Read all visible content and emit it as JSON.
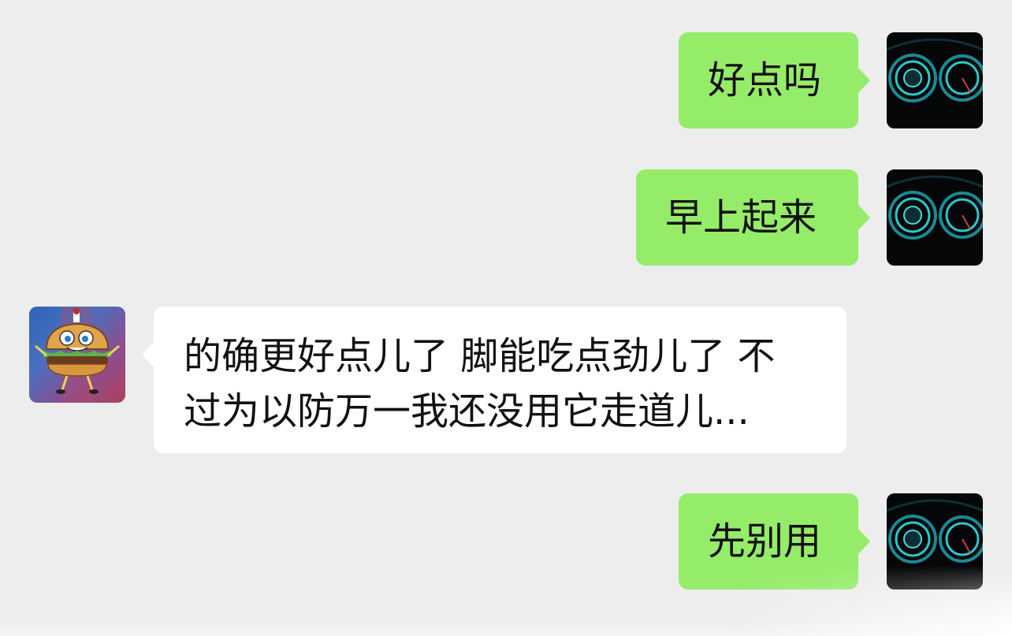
{
  "chat": {
    "messages": [
      {
        "sender": "self",
        "text": "好点吗",
        "avatar_icon": "dashboard-gauges-icon"
      },
      {
        "sender": "self",
        "text": "早上起来",
        "avatar_icon": "dashboard-gauges-icon"
      },
      {
        "sender": "other",
        "line1": "的确更好点儿了 脚能吃点劲儿了 不",
        "line2": "过为以防万一我还没用它走道儿...",
        "avatar_icon": "cartoon-burger-icon"
      },
      {
        "sender": "self",
        "text": "先别用",
        "avatar_icon": "dashboard-gauges-icon"
      }
    ]
  },
  "colors": {
    "background": "#ededed",
    "outgoing_bubble": "#95ec69",
    "incoming_bubble": "#ffffff",
    "text": "#111111"
  }
}
